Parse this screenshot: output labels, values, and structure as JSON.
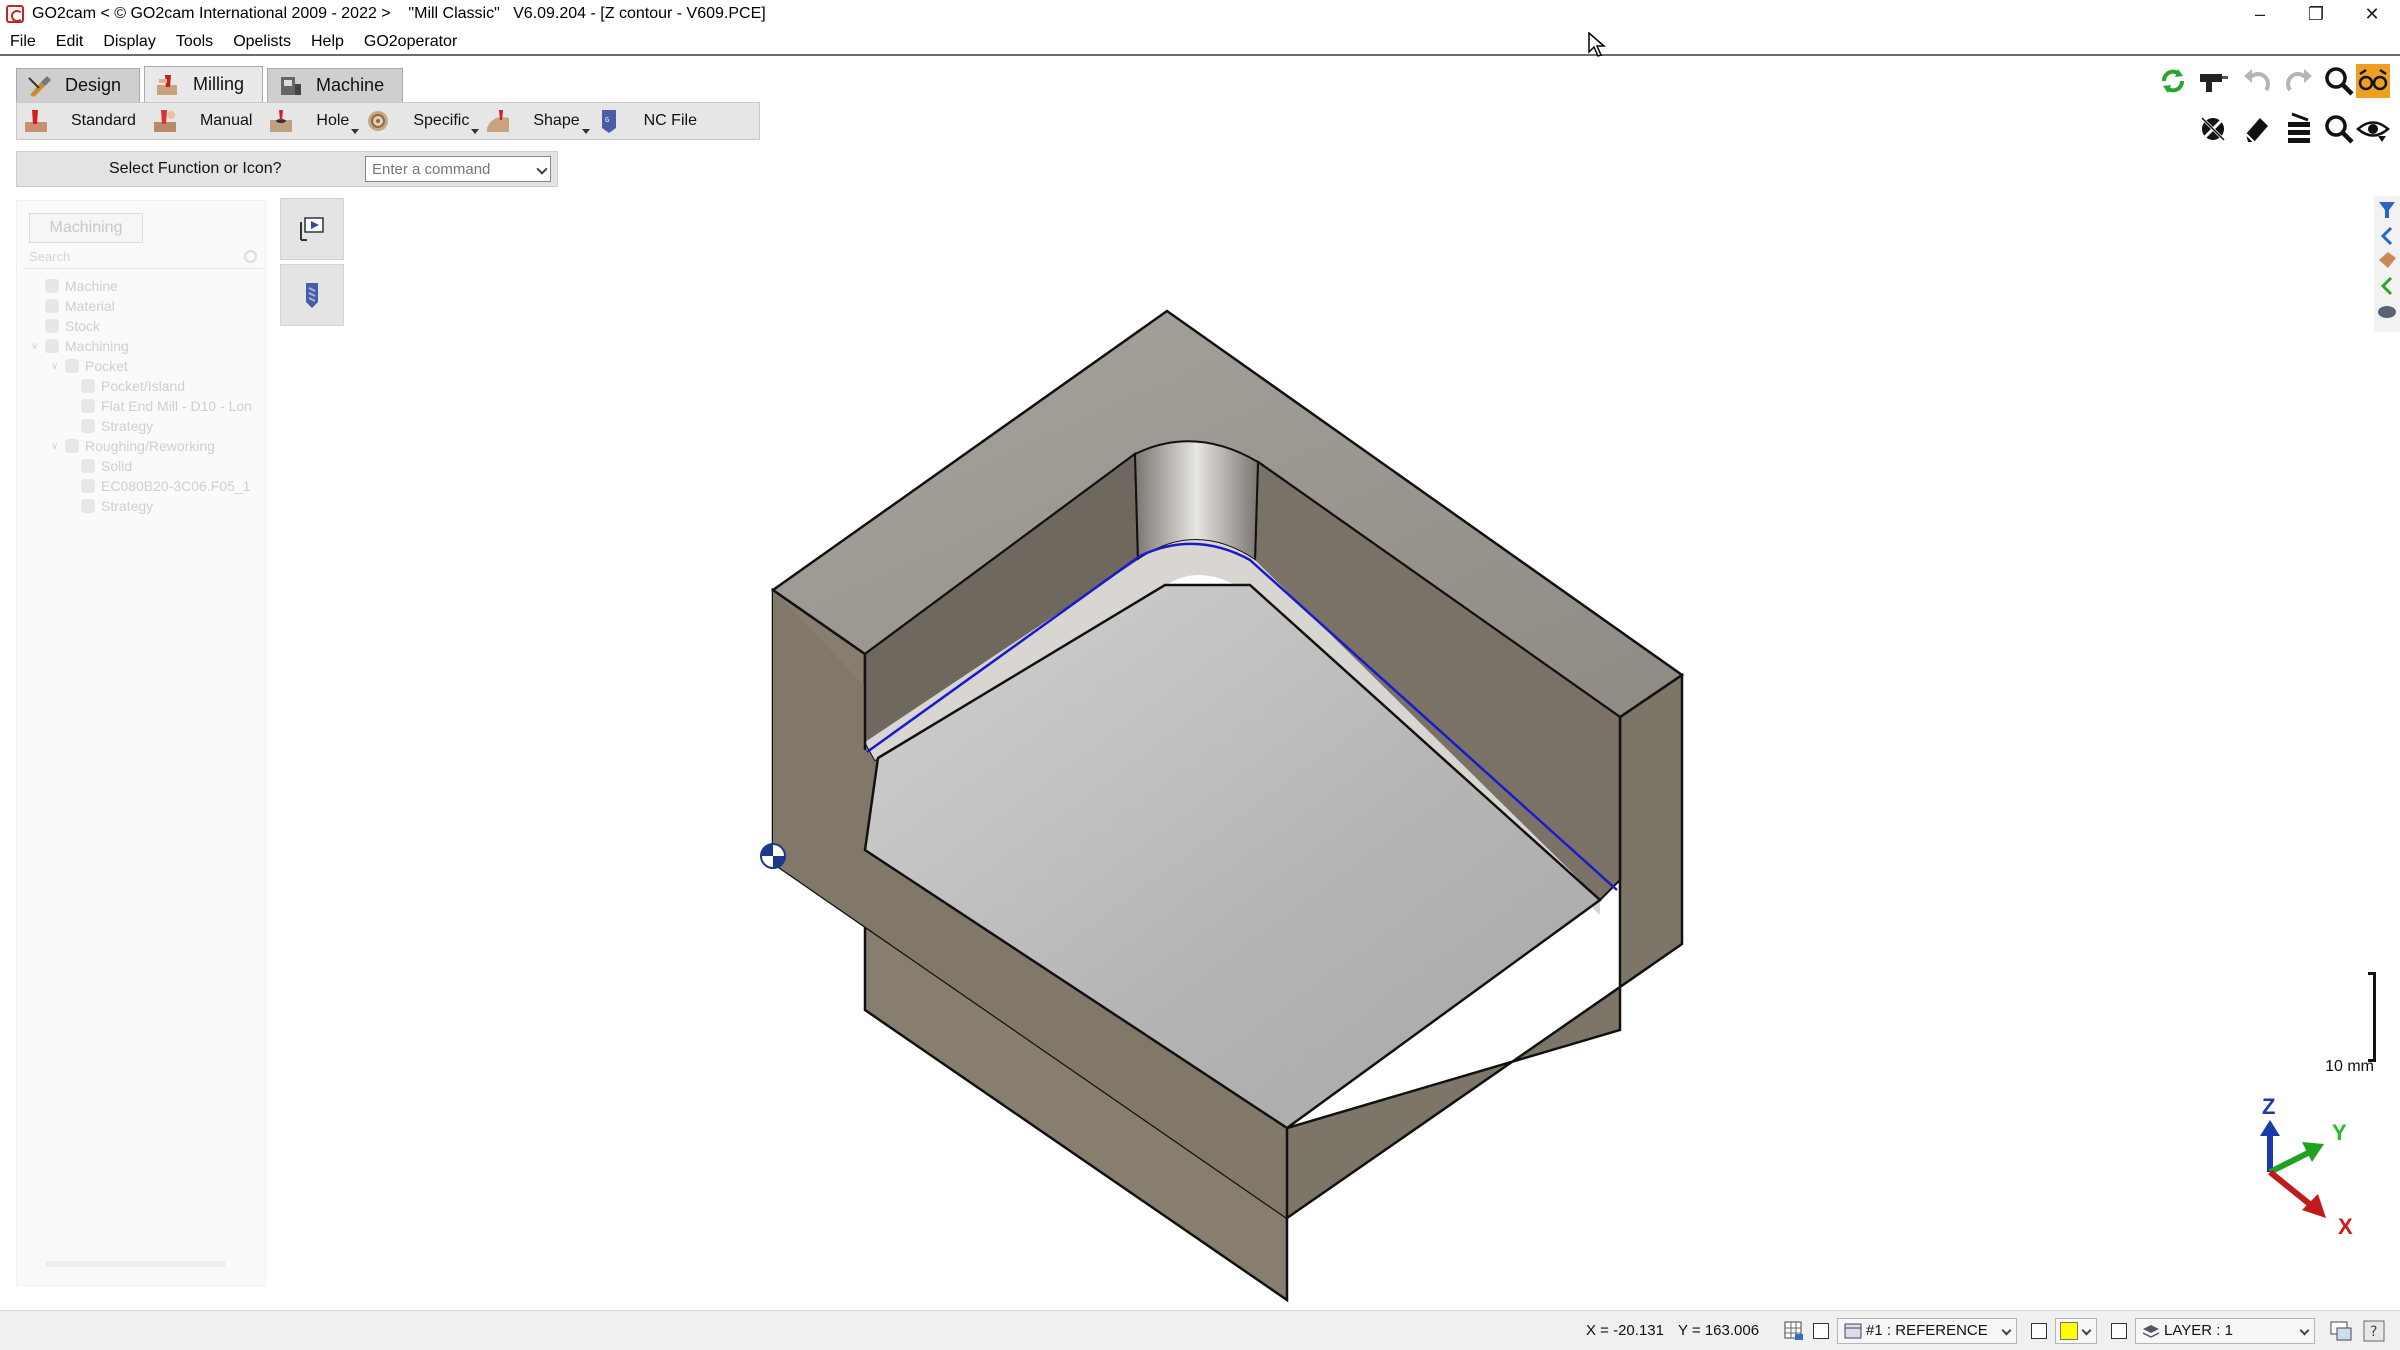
{
  "window": {
    "title": "GO2cam < © GO2cam International 2009 - 2022 >    \"Mill Classic\"   V6.09.204 - [Z contour - V609.PCE]",
    "controls": [
      "minimize",
      "restore",
      "close"
    ]
  },
  "menu": [
    "File",
    "Edit",
    "Display",
    "Tools",
    "Opelists",
    "Help",
    "GO2operator"
  ],
  "tabs": [
    {
      "label": "Design",
      "icon": "design-icon",
      "active": false
    },
    {
      "label": "Milling",
      "icon": "milling-icon",
      "active": true
    },
    {
      "label": "Machine",
      "icon": "machine-icon",
      "active": false
    }
  ],
  "ribbon": [
    {
      "label": "Standard",
      "icon": "standard-milling-icon",
      "has_menu": false
    },
    {
      "label": "Manual",
      "icon": "manual-milling-icon",
      "has_menu": false
    },
    {
      "label": "Hole",
      "icon": "hole-icon",
      "has_menu": true
    },
    {
      "label": "Specific",
      "icon": "specific-icon",
      "has_menu": true
    },
    {
      "label": "Shape",
      "icon": "shape-icon",
      "has_menu": true
    },
    {
      "label": "NC File",
      "icon": "nc-file-icon",
      "has_menu": false
    }
  ],
  "command": {
    "label": "Select Function or Icon?",
    "placeholder": "Enter a command"
  },
  "tree": {
    "tab": "Machining",
    "search_placeholder": "Search",
    "items": [
      {
        "label": "Machine",
        "level": 0
      },
      {
        "label": "Material",
        "level": 0
      },
      {
        "label": "Stock",
        "level": 0
      },
      {
        "label": "Machining",
        "level": 0,
        "expanded": true
      },
      {
        "label": "Pocket",
        "level": 1,
        "expanded": true
      },
      {
        "label": "Pocket/Island",
        "level": 2
      },
      {
        "label": "Flat End Mill - D10 - Lon",
        "level": 2
      },
      {
        "label": "Strategy",
        "level": 2
      },
      {
        "label": "Roughing/Reworking",
        "level": 1,
        "expanded": true
      },
      {
        "label": "Solid",
        "level": 2
      },
      {
        "label": "EC080B20-3C06.F05_1",
        "level": 2
      },
      {
        "label": "Strategy",
        "level": 2
      }
    ]
  },
  "side_buttons": [
    "play-simulation-icon",
    "tool-icon"
  ],
  "right_toolbar": {
    "row1": [
      "refresh-icon",
      "drill-gun-icon",
      "undo-icon",
      "redo-icon",
      "zoom-icon",
      "glasses-icon"
    ],
    "row2": [
      "hide-icon",
      "eraser-icon",
      "layers-icon",
      "zoom-window-icon",
      "visibility-icon"
    ]
  },
  "edge_strip": [
    "filter-icon",
    "collapse-left-icon",
    "machine-part-icon",
    "collapse-left-icon-2",
    "stock-icon"
  ],
  "scale": {
    "label": "10 mm"
  },
  "triad": {
    "z": "Z",
    "y": "Y",
    "x": "X"
  },
  "status": {
    "x": "X = -20.131",
    "y": "Y = 163.006",
    "reference": "#1 : REFERENCE",
    "color": "#ffff00",
    "layer": "LAYER : 1"
  },
  "colors": {
    "toolpath": "#1a1acc",
    "part_top": "#9c9690",
    "part_side": "#857c6f"
  }
}
